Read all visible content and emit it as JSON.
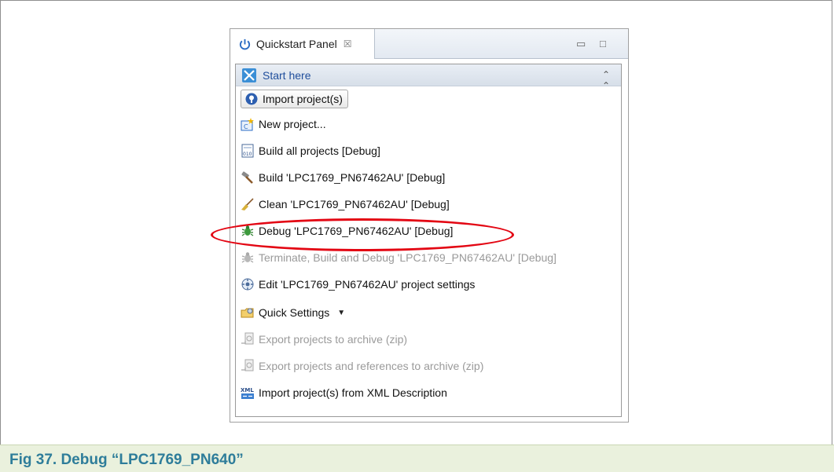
{
  "panel": {
    "tab_title": "Quickstart Panel",
    "tab_close": "☒",
    "minimize": "▭",
    "maximize": "□"
  },
  "section": {
    "title": "Start here",
    "collapse": "⌃⌃"
  },
  "items": [
    {
      "label": "Import project(s)",
      "icon": "bulb-icon",
      "enabled": true
    },
    {
      "label": "New project...",
      "icon": "new-project-icon",
      "enabled": true
    },
    {
      "label": "Build all projects [Debug]",
      "icon": "build-all-icon",
      "enabled": true
    },
    {
      "label": "Build 'LPC1769_PN67462AU' [Debug]",
      "icon": "hammer-icon",
      "enabled": true
    },
    {
      "label": "Clean 'LPC1769_PN67462AU' [Debug]",
      "icon": "broom-icon",
      "enabled": true
    },
    {
      "label": "Debug 'LPC1769_PN67462AU' [Debug]",
      "icon": "bug-icon",
      "enabled": true
    },
    {
      "label": "Terminate, Build and Debug 'LPC1769_PN67462AU' [Debug]",
      "icon": "bug-icon",
      "enabled": false
    },
    {
      "label": "Edit 'LPC1769_PN67462AU' project settings",
      "icon": "settings-icon",
      "enabled": true
    },
    {
      "label": "Quick Settings",
      "icon": "folder-icon",
      "enabled": true
    },
    {
      "label": "Export projects to archive (zip)",
      "icon": "export-icon",
      "enabled": false
    },
    {
      "label": "Export projects and references to archive (zip)",
      "icon": "export-icon",
      "enabled": false
    },
    {
      "label": "Import project(s) from XML Description",
      "icon": "xml-icon",
      "enabled": true
    }
  ],
  "caption": {
    "text": "Fig 37.   Debug “LPC1769_PN640”"
  },
  "colors": {
    "highlight": "#e30613",
    "caption_bg": "#eaf1dd",
    "caption_text": "#2e7d9a",
    "section_text": "#1f4e9c"
  }
}
